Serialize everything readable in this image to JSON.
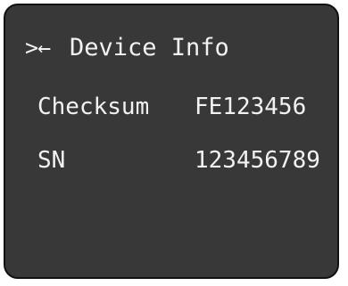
{
  "colors": {
    "screen_background": "#383838",
    "screen_border": "#111111",
    "text": "#f2f2f2"
  },
  "header": {
    "nav_icon": ">←",
    "title": "Device Info"
  },
  "rows": [
    {
      "label": "Checksum",
      "value": "FE123456"
    },
    {
      "label": "SN",
      "value": "123456789"
    }
  ]
}
